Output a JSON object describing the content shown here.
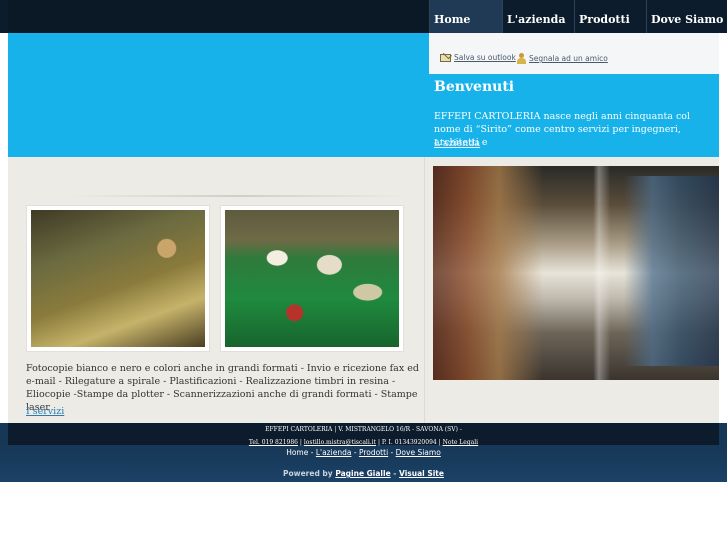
{
  "nav": {
    "items": [
      "Home",
      "L'azienda",
      "Prodotti",
      "Dove Siamo"
    ]
  },
  "tools": {
    "save_outlook": "Salva su outlook",
    "recommend": "Segnala ad un amico"
  },
  "welcome": {
    "title": "Benvenuti",
    "text": "EFFEPI CARTOLERIA nasce negli anni cinquanta col nome di “Sirito” come centro servizi per ingegneri, architetti e",
    "link": "L'azienda"
  },
  "services": {
    "description": "Fotocopie bianco e nero e colori anche in grandi formati - Invio e ricezione fax ed e-mail - Rilegature a spirale - Plastificazioni - Realizzazione timbri in resina - Eliocopie -Stampe da plotter - Scannerizzazioni anche di grandi formati - Stampe laser",
    "link": "I servizi"
  },
  "footer": {
    "address": "EFFEPI CARTOLERIA | V. MISTRANGELO 16/R - SAVONA (SV) -",
    "phone": "Tel. 019 821986",
    "sep": "|",
    "email": "lostillo.mistra@tiscali.it",
    "vat": "P. I. 01343920094",
    "legal": "Note Legali",
    "links": [
      "Home",
      "L'azienda",
      "Prodotti",
      "Dove Siamo"
    ],
    "dash": "-",
    "powered_by": "Powered by",
    "pagine_gialle": "Pagine Gialle",
    "visual_site": "Visual Site"
  }
}
